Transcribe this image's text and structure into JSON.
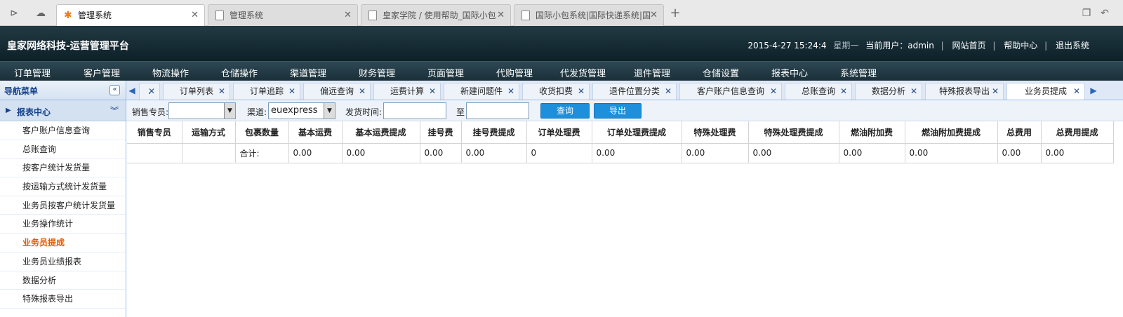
{
  "browser": {
    "tabs": [
      {
        "label": "管理系统"
      },
      {
        "label": "管理系统"
      },
      {
        "label": "皇家学院 / 使用帮助_国际小包"
      },
      {
        "label": "国际小包系统|国际快递系统|国"
      }
    ]
  },
  "header": {
    "title": "皇家网络科技-运营管理平台",
    "datetime": "2015-4-27 15:24:4",
    "weekday": "星期一",
    "current_user_label": "当前用户：",
    "current_user": "admin",
    "links": [
      "网站首页",
      "帮助中心",
      "退出系统"
    ]
  },
  "menu": [
    "订单管理",
    "客户管理",
    "物流操作",
    "仓储操作",
    "渠道管理",
    "财务管理",
    "页面管理",
    "代购管理",
    "代发货管理",
    "退件管理",
    "仓储设置",
    "报表中心",
    "系统管理"
  ],
  "sidebar": {
    "title": "导航菜单",
    "section": "报表中心",
    "items": [
      "客户账户信息查询",
      "总账查询",
      "按客户统计发货量",
      "按运输方式统计发货量",
      "业务员按客户统计发货量",
      "业务操作统计",
      "业务员提成",
      "业务员业绩报表",
      "数据分析",
      "特殊报表导出"
    ],
    "active_index": 6
  },
  "content_tabs": [
    ".",
    "订单列表",
    "订单追踪",
    "偏远查询",
    "运费计算",
    "新建问题件",
    "收货扣费",
    "退件位置分类",
    "客户账户信息查询",
    "总账查询",
    "数据分析",
    "特殊报表导出",
    "业务员提成"
  ],
  "filter": {
    "salesperson_label": "销售专员:",
    "salesperson_value": "",
    "channel_label": "渠道:",
    "channel_value": "euexpress",
    "ship_time_label": "发货时间:",
    "date_from": "",
    "to_label": "至",
    "date_to": "",
    "query_button": "查询",
    "export_button": "导出"
  },
  "table": {
    "columns": [
      "销售专员",
      "运输方式",
      "包裹数量",
      "基本运费",
      "基本运费提成",
      "挂号费",
      "挂号费提成",
      "订单处理费",
      "订单处理费提成",
      "特殊处理费",
      "特殊处理费提成",
      "燃油附加费",
      "燃油附加费提成",
      "总费用",
      "总费用提成"
    ],
    "rows": [
      [
        "",
        "",
        "合计:",
        "0.00",
        "0.00",
        "0.00",
        "0.00",
        "0",
        "0.00",
        "0.00",
        "0.00",
        "0.00",
        "0.00",
        "0.00",
        "0.00"
      ]
    ]
  }
}
